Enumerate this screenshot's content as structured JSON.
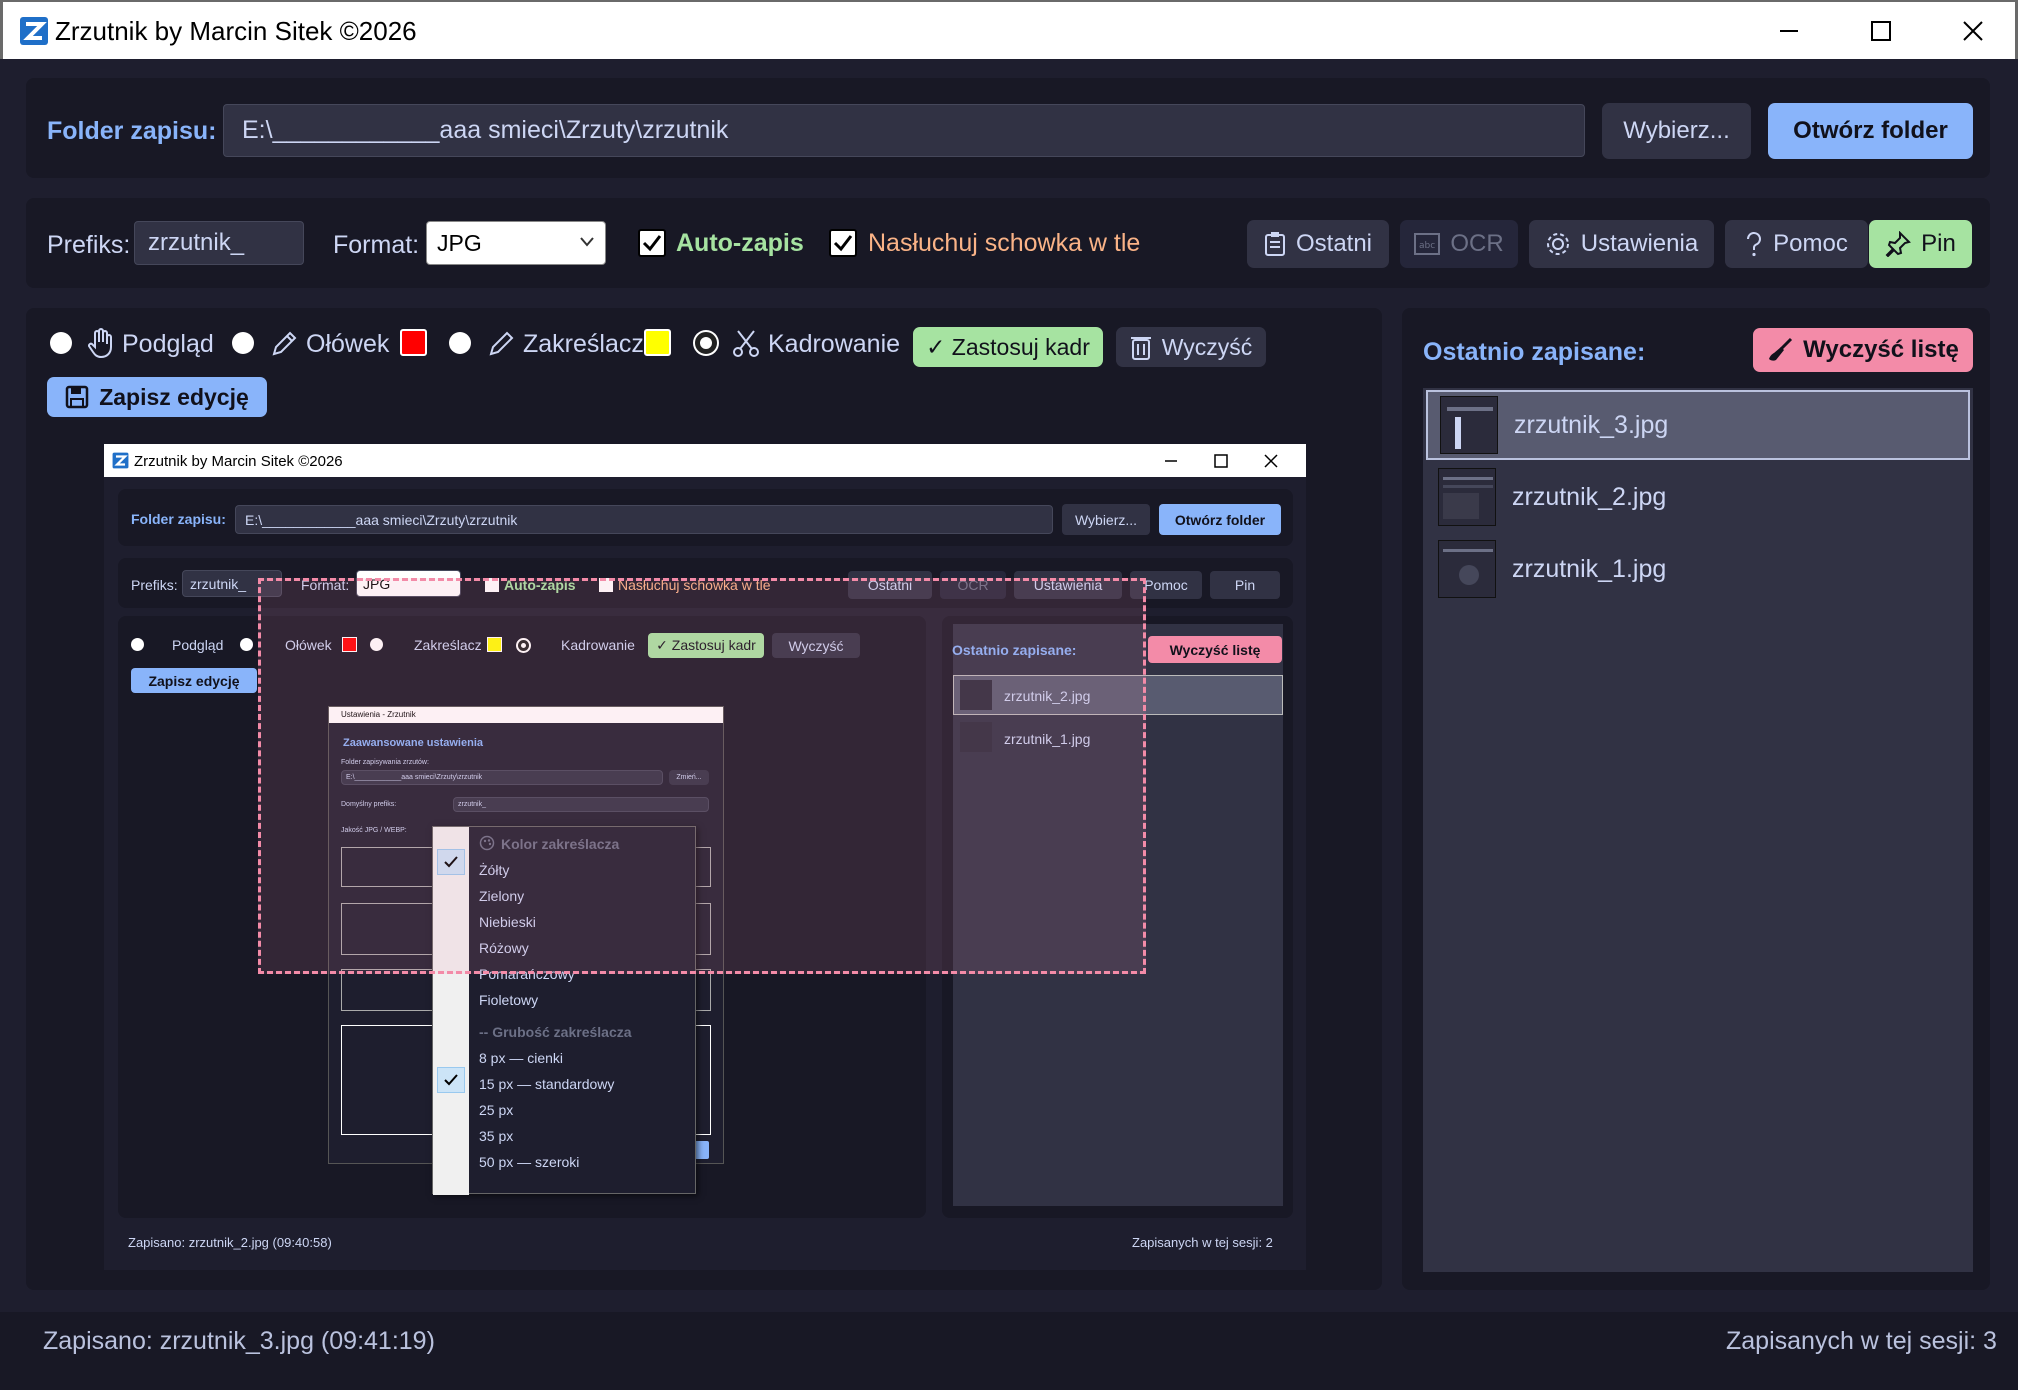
{
  "window": {
    "title": "Zrzutnik by Marcin Sitek ©2026"
  },
  "folder": {
    "label": "Folder zapisu:",
    "path": "E:\\____________aaa smieci\\Zrzuty\\zrzutnik",
    "choose_btn": "Wybierz...",
    "open_btn": "Otwórz folder"
  },
  "options": {
    "prefix_label": "Prefiks:",
    "prefix_value": "zrzutnik_",
    "format_label": "Format:",
    "format_value": "JPG",
    "autosave_label": "Auto-zapis",
    "listen_label": "Nasłuchuj schowka w tle",
    "recent_btn": "Ostatni",
    "ocr_btn": "OCR",
    "settings_btn": "Ustawienia",
    "help_btn": "Pomoc",
    "pin_btn": "Pin"
  },
  "tools": {
    "preview": "Podgląd",
    "pencil": "Ołówek",
    "highlighter": "Zakreślacz",
    "crop": "Kadrowanie",
    "apply_crop": "✓ Zastosuj kadr",
    "clear": "Wyczyść",
    "save_edit": "Zapisz edycję"
  },
  "colors": {
    "pencil_color": "#ff0000",
    "highlighter_color": "#ffff00",
    "accent_blue": "#89b4fa",
    "accent_green": "#a6e3a1",
    "accent_pink": "#f38ba8",
    "warn_orange": "#fab387"
  },
  "recent": {
    "title": "Ostatnio zapisane:",
    "clear_btn": "Wyczyść listę",
    "items": [
      "zrzutnik_3.jpg",
      "zrzutnik_2.jpg",
      "zrzutnik_1.jpg"
    ]
  },
  "status": {
    "left": "Zapisano: zrzutnik_3.jpg (09:41:19)",
    "right": "Zapisanych w tej sesji: 3"
  },
  "embedded": {
    "title": "Zrzutnik by Marcin Sitek ©2026",
    "folder_label": "Folder zapisu:",
    "folder_path": "E:\\____________aaa smieci\\Zrzuty\\zrzutnik",
    "choose_btn": "Wybierz...",
    "open_btn": "Otwórz folder",
    "prefix_label": "Prefiks:",
    "prefix_value": "zrzutnik_",
    "format_label": "Format:",
    "format_value": "JPG",
    "autosave_label": "Auto-zapis",
    "listen_label": "Nasłuchuj schowka w tle",
    "recent_btn": "Ostatni",
    "ocr_btn": "OCR",
    "settings_btn": "Ustawienia",
    "help_btn": "Pomoc",
    "pin_btn": "Pin",
    "preview": "Podgląd",
    "pencil": "Ołówek",
    "highlighter": "Zakreślacz",
    "crop": "Kadrowanie",
    "apply_crop": "✓ Zastosuj kadr",
    "clear": "Wyczyść",
    "save_edit": "Zapisz edycję",
    "recent_title": "Ostatnio zapisane:",
    "recent_clear": "Wyczyść listę",
    "recent_items": [
      "zrzutnik_2.jpg",
      "zrzutnik_1.jpg"
    ],
    "status_left": "Zapisano: zrzutnik_2.jpg (09:40:58)",
    "status_right": "Zapisanych w tej sesji: 2",
    "settings_window_title": "Ustawienia - Zrzutnik",
    "settings_heading": "Zaawansowane ustawienia",
    "settings_folder_label": "Folder zapisywania zrzutów:",
    "settings_folder_value": "E:\\____________aaa smieci\\Zrzuty\\zrzutnik",
    "settings_choose": "Zmień...",
    "settings_prefix_label": "Domyślny prefiks:",
    "settings_prefix_value": "zrzutnik_",
    "settings_quality_label": "Jakość JPG / WEBP:",
    "menu": {
      "color_header": "Kolor zakreślacza",
      "colors": [
        "Żółty",
        "Zielony",
        "Niebieski",
        "Różowy",
        "Pomarańczowy",
        "Fioletowy"
      ],
      "width_header": "-- Grubość zakreślacza",
      "widths": [
        "8 px — cienki",
        "15 px — standardowy",
        "25 px",
        "35 px",
        "50 px — szeroki"
      ]
    }
  }
}
